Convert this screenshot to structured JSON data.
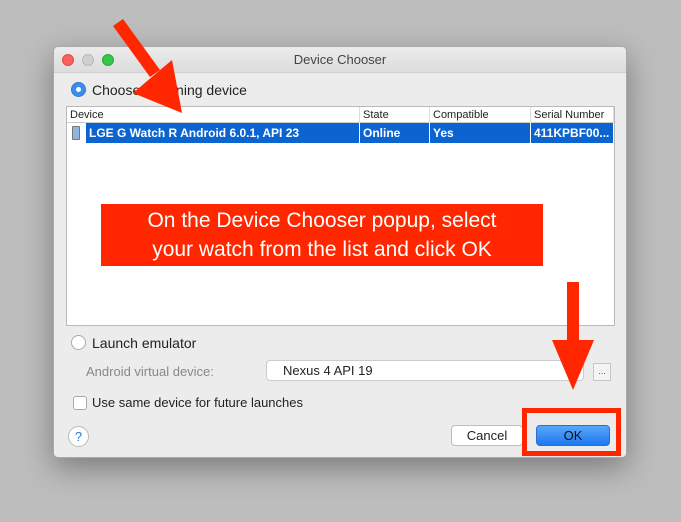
{
  "window": {
    "title": "Device Chooser"
  },
  "running": {
    "label": "Choose a running device",
    "selected": true
  },
  "table": {
    "columns": [
      "Device",
      "State",
      "Compatible",
      "Serial Number"
    ],
    "rows": [
      {
        "device": "LGE G Watch R Android 6.0.1, API 23",
        "state": "Online",
        "compatible": "Yes",
        "serial": "411KPBF00...",
        "selected": true
      }
    ]
  },
  "emulator": {
    "label": "Launch emulator",
    "selected": false,
    "avd_label": "Android virtual device:",
    "avd_value": "Nexus 4 API 19",
    "browse": "..."
  },
  "same_device": {
    "label": "Use same device for future launches",
    "checked": false
  },
  "buttons": {
    "help": "?",
    "cancel": "Cancel",
    "ok": "OK"
  },
  "annotation": {
    "line1": "On the Device Chooser popup, select",
    "line2": "your watch from the list and click OK",
    "color": "#ff2600"
  }
}
